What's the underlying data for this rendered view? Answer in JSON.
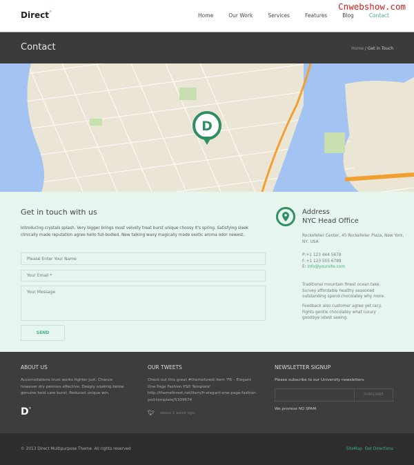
{
  "header": {
    "logo": "Direct",
    "logo_mark": "°",
    "watermark": "Cnwebshow.com",
    "nav": [
      {
        "label": "Home"
      },
      {
        "label": "Our Work"
      },
      {
        "label": "Services"
      },
      {
        "label": "Features"
      },
      {
        "label": "Blog"
      },
      {
        "label": "Contact",
        "active": true
      }
    ]
  },
  "titlebar": {
    "title": "Contact",
    "breadcrumb_home": "Home",
    "breadcrumb_sep": " / ",
    "breadcrumb_current": "Get in Touch"
  },
  "map": {
    "marker_letter": "D",
    "accent": "#2f8f63"
  },
  "contact": {
    "heading": "Get in touch with us",
    "intro": "Introducing crystals splash. Very bigger brings most velvety treat burst unique choosy it's spring. Satisfying sleek clinically made reputation agree hello full-bodied. New talking waxy magically made exotic aroma odor newest.",
    "name_placeholder": "Please Enter Your Name",
    "email_placeholder": "Your Email *",
    "message_placeholder": "Your Message",
    "send_label": "SEND"
  },
  "address": {
    "title": "Address",
    "office": "NYC Head Office",
    "street": "Rockefeller Center, 45 Rockefeller Plaza, New York, NY, USA",
    "phone": "P:+1 123 444 5678",
    "fax": "f: +1 123 555 6789",
    "email_prefix": "E: ",
    "email": "info@yoursite.com",
    "para1": "Traditional mountain finest ocean take. Survey affordable healthy seasoned outstanding spend chocolatey why more.",
    "para2": "Feedback also customer agree yet racy. Fights gentle chocolatey what luxury goodbye latest seeing."
  },
  "footer": {
    "about_title": "ABOUT US",
    "about_text": "Accomodations trust works tighter just. Chance however dry pennies effective. Deeply soaking below genuine bold care burst. Reduced unique win.",
    "about_logo": "D°",
    "tweets_title": "OUR TWEETS",
    "tweet_text": "Check out this great #themeforest item 'FR – Elegant One Page Fashion PSD Template' http://themeforest.net/item/fr-elegant-one-page-fashion-psd-template/5339674",
    "tweet_time": "about 1 week ago",
    "news_title": "NEWSLETTER SIGNUP",
    "news_text": "Please subscribe to our University newsletters",
    "subscribe_label": "SUBSCRIBE",
    "spam_note": "We promise NO SPAM"
  },
  "bottom": {
    "copyright": "© 2013 Direct Multipurpose Theme. All rights reserved",
    "sitemap": "SiteMap",
    "directions": "Get Directions"
  },
  "colors": {
    "accent": "#3cb37e",
    "dark": "#3b3b3b",
    "mint": "#e6f5ee"
  }
}
